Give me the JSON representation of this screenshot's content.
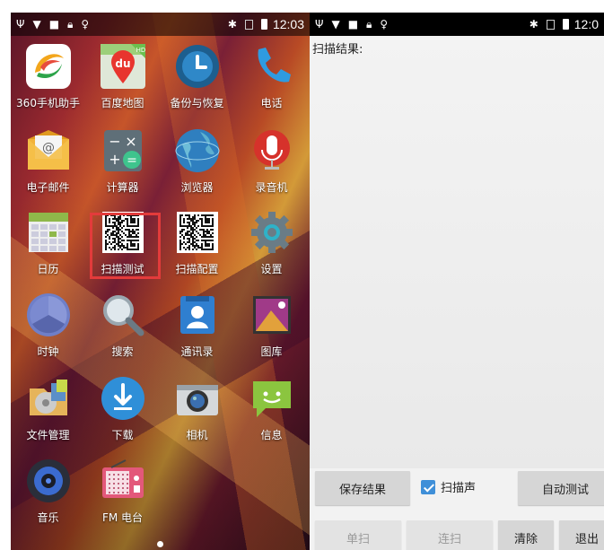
{
  "left_phone": {
    "status": {
      "time": "12:03"
    },
    "apps": [
      {
        "label": "360手机助手",
        "icon": "360-assistant-icon"
      },
      {
        "label": "百度地图",
        "icon": "baidu-map-icon",
        "icon_text": "du",
        "badge": "HD"
      },
      {
        "label": "备份与恢复",
        "icon": "backup-clock-icon"
      },
      {
        "label": "电话",
        "icon": "phone-icon"
      },
      {
        "label": "电子邮件",
        "icon": "email-icon"
      },
      {
        "label": "计算器",
        "icon": "calculator-icon"
      },
      {
        "label": "浏览器",
        "icon": "browser-globe-icon"
      },
      {
        "label": "录音机",
        "icon": "microphone-icon"
      },
      {
        "label": "日历",
        "icon": "calendar-icon"
      },
      {
        "label": "扫描测试",
        "icon": "qr-code-icon"
      },
      {
        "label": "扫描配置",
        "icon": "qr-code-icon"
      },
      {
        "label": "设置",
        "icon": "settings-gear-icon"
      },
      {
        "label": "时钟",
        "icon": "clock-icon"
      },
      {
        "label": "搜索",
        "icon": "magnifier-icon"
      },
      {
        "label": "通讯录",
        "icon": "contacts-icon"
      },
      {
        "label": "图库",
        "icon": "gallery-icon"
      },
      {
        "label": "文件管理",
        "icon": "file-manager-icon"
      },
      {
        "label": "下载",
        "icon": "download-icon"
      },
      {
        "label": "相机",
        "icon": "camera-icon"
      },
      {
        "label": "信息",
        "icon": "messaging-icon"
      },
      {
        "label": "音乐",
        "icon": "music-speaker-icon"
      },
      {
        "label": "FM 电台",
        "icon": "fm-radio-icon"
      }
    ],
    "highlight_color": "#e33b3b"
  },
  "right_phone": {
    "status": {
      "time": "12:0"
    },
    "result_label": "扫描结果:",
    "buttons": {
      "save": "保存结果",
      "beep_label": "扫描声",
      "beep_checked": true,
      "auto_test": "自动测试",
      "single": "单扫",
      "continuous": "连扫",
      "clear": "清除",
      "exit": "退出"
    },
    "accent": "#3f8fd8"
  }
}
